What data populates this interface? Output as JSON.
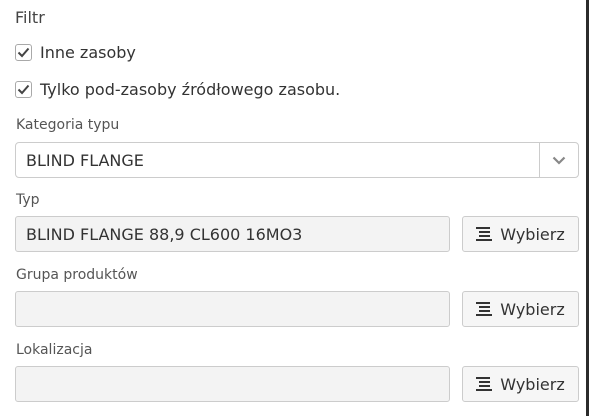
{
  "filter": {
    "title": "Filtr",
    "checkboxes": [
      {
        "label": "Inne zasoby",
        "checked": true
      },
      {
        "label": "Tylko pod-zasoby źródłowego zasobu.",
        "checked": true
      }
    ]
  },
  "fields": {
    "category": {
      "label": "Kategoria typu",
      "value": "BLIND FLANGE"
    },
    "type": {
      "label": "Typ",
      "value": "BLIND FLANGE 88,9 CL600 16MO3",
      "button": "Wybierz"
    },
    "product_group": {
      "label": "Grupa produktów",
      "value": "",
      "button": "Wybierz"
    },
    "location": {
      "label": "Lokalizacja",
      "value": "",
      "button": "Wybierz"
    }
  },
  "icons": {
    "checkmark": "check-icon",
    "dropdown": "chevron-down-icon",
    "select_button": "list-icon"
  }
}
